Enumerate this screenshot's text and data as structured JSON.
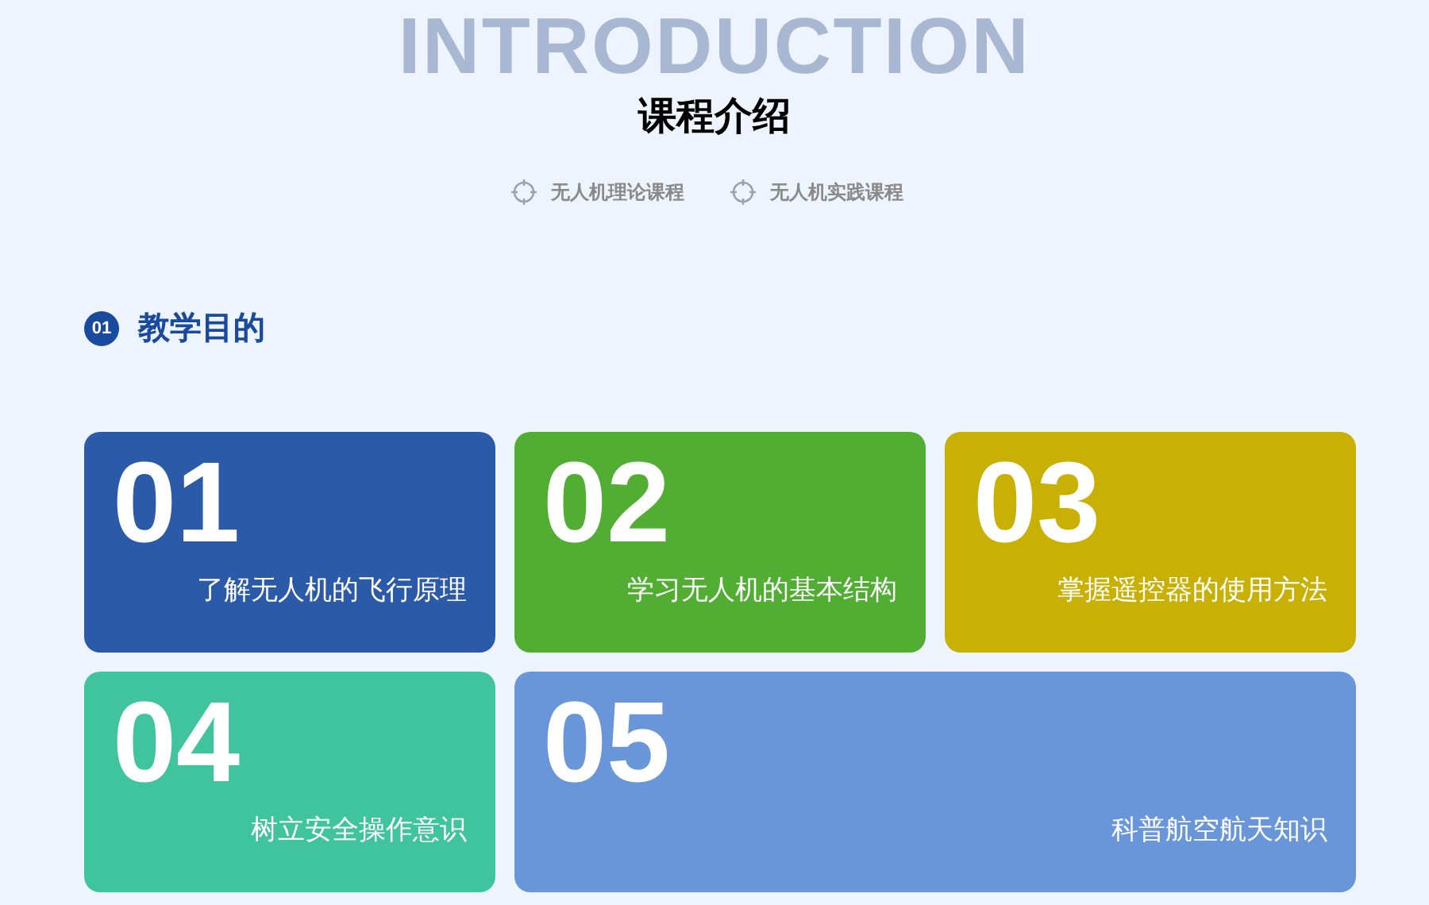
{
  "header": {
    "background_word": "INTRODUCTION",
    "title": "课程介绍"
  },
  "course_links": [
    {
      "label": "无人机理论课程"
    },
    {
      "label": "无人机实践课程"
    }
  ],
  "section": {
    "number": "01",
    "title": "教学目的"
  },
  "goals": [
    {
      "number": "01",
      "text": "了解无人机的飞行原理",
      "color": "#2b5aa8",
      "wide": false
    },
    {
      "number": "02",
      "text": "学习无人机的基本结构",
      "color": "#52ad33",
      "wide": false
    },
    {
      "number": "03",
      "text": "掌握遥控器的使用方法",
      "color": "#c9b004",
      "wide": false
    },
    {
      "number": "04",
      "text": "树立安全操作意识",
      "color": "#3fc49d",
      "wide": false
    },
    {
      "number": "05",
      "text": "科普航空航天知识",
      "color": "#6896d8",
      "wide": true
    }
  ]
}
